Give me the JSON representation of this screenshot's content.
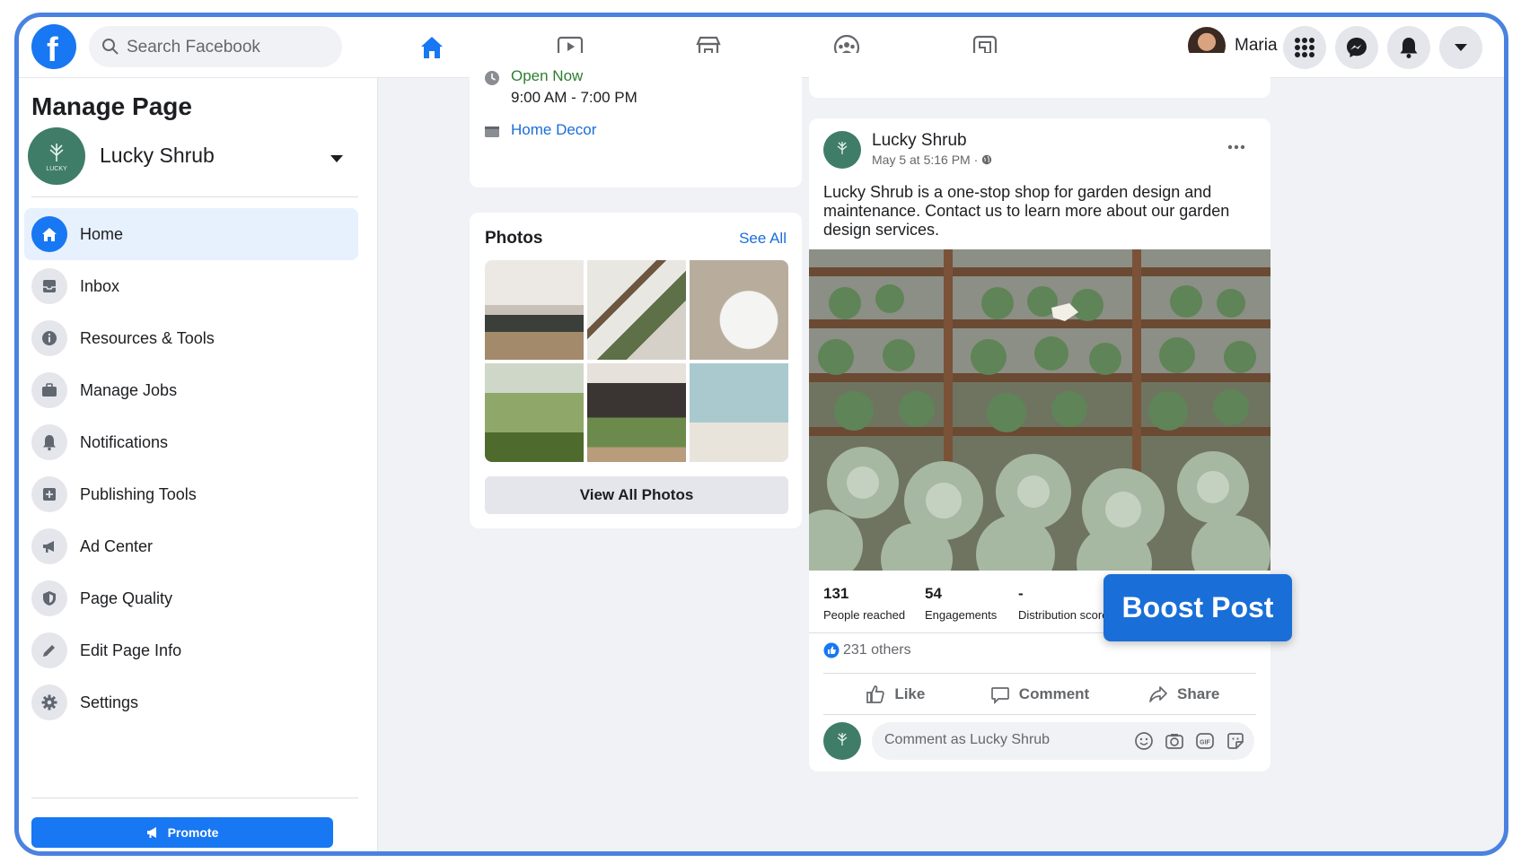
{
  "topnav": {
    "search_placeholder": "Search Facebook",
    "user_name": "Maria",
    "icons": [
      "facebook-logo",
      "home-icon",
      "watch-icon",
      "marketplace-icon",
      "groups-icon",
      "gaming-icon",
      "menu-grid-icon",
      "messenger-icon",
      "bell-icon",
      "caret-down-icon"
    ],
    "accent": "#1877f2"
  },
  "sidebar": {
    "title": "Manage Page",
    "page_name": "Lucky Shrub",
    "items": [
      {
        "label": "Home",
        "icon": "home-icon",
        "active": true
      },
      {
        "label": "Inbox",
        "icon": "inbox-icon"
      },
      {
        "label": "Resources & Tools",
        "icon": "info-icon"
      },
      {
        "label": "Manage Jobs",
        "icon": "briefcase-icon"
      },
      {
        "label": "Notifications",
        "icon": "bell-icon"
      },
      {
        "label": "Publishing Tools",
        "icon": "publishing-icon"
      },
      {
        "label": "Ad Center",
        "icon": "megaphone-icon"
      },
      {
        "label": "Page Quality",
        "icon": "shield-icon"
      },
      {
        "label": "Edit Page Info",
        "icon": "pencil-icon"
      },
      {
        "label": "Settings",
        "icon": "gear-icon"
      }
    ],
    "promote_label": "Promote"
  },
  "info": {
    "open_status": "Open Now",
    "hours": "9:00 AM - 7:00 PM",
    "category": "Home Decor"
  },
  "photos": {
    "title": "Photos",
    "see_all": "See All",
    "view_all": "View All Photos"
  },
  "post": {
    "author": "Lucky Shrub",
    "date": "May 5 at 5:16 PM · ",
    "text": "Lucky Shrub is a one-stop shop for garden design and maintenance. Contact us to learn more about our garden design services.",
    "stats": [
      {
        "value": "131",
        "label": "People reached"
      },
      {
        "value": "54",
        "label": "Engagements"
      },
      {
        "value": "-",
        "label": "Distribution score"
      }
    ],
    "reactions": "231 others",
    "actions": {
      "like": "Like",
      "comment": "Comment",
      "share": "Share"
    },
    "comment_placeholder": "Comment as Lucky Shrub",
    "boost_label": "Boost Post"
  }
}
